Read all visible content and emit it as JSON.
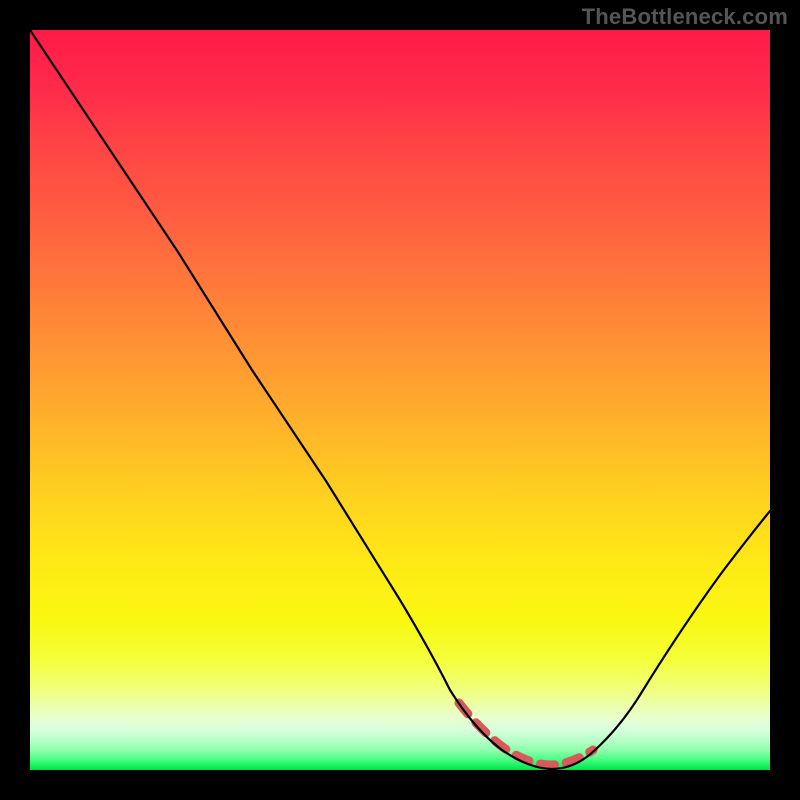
{
  "watermark": "TheBottleneck.com",
  "chart_data": {
    "type": "line",
    "title": "",
    "xlabel": "",
    "ylabel": "",
    "xlim": [
      0,
      100
    ],
    "ylim": [
      0,
      100
    ],
    "grid": false,
    "legend": false,
    "background": "gradient red→green (top→bottom)",
    "series": [
      {
        "name": "bottleneck-curve",
        "x": [
          0,
          10,
          20,
          30,
          40,
          50,
          55,
          58,
          62,
          66,
          70,
          73,
          76,
          82,
          88,
          94,
          100
        ],
        "values": [
          100,
          85,
          70,
          54,
          39,
          23,
          15,
          9,
          4,
          1,
          0,
          0,
          1,
          5,
          13,
          23,
          35
        ]
      }
    ],
    "annotations": [
      {
        "name": "optimal-range-dashes",
        "color": "#d65a5a",
        "x_range": [
          58,
          76
        ],
        "note": "dashed segment along valley bottom"
      }
    ]
  }
}
